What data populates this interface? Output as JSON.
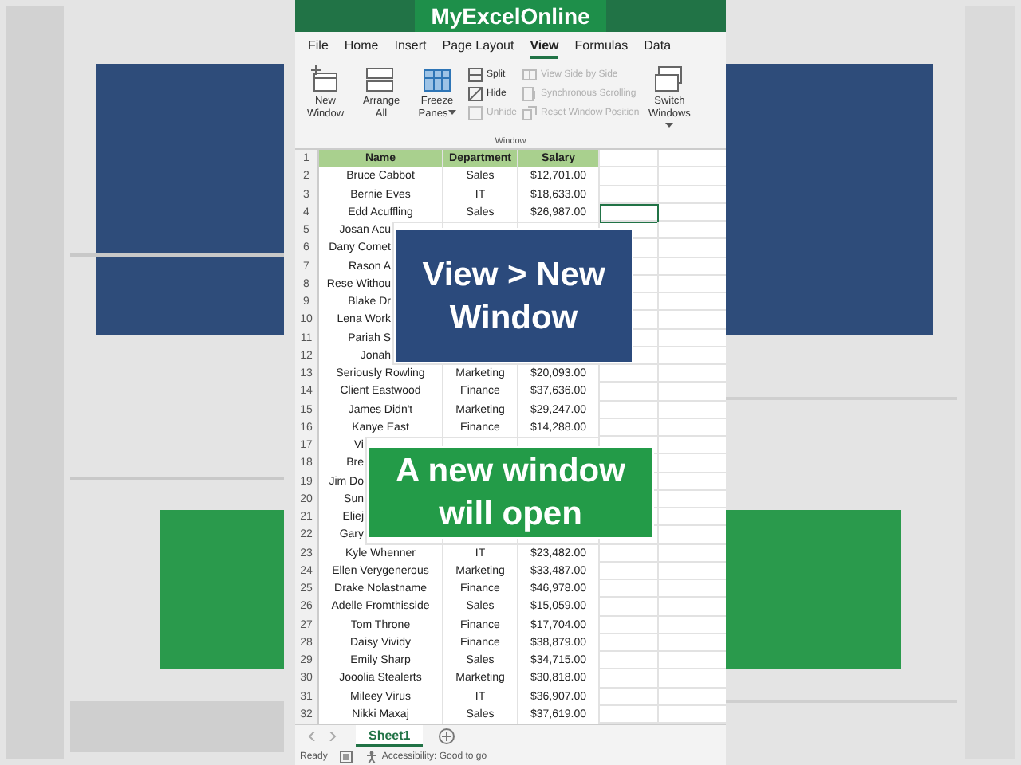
{
  "title": "MyExcelOnline",
  "tabs": [
    {
      "label": "File",
      "selected": false
    },
    {
      "label": "Home",
      "selected": false
    },
    {
      "label": "Insert",
      "selected": false
    },
    {
      "label": "Page Layout",
      "selected": false
    },
    {
      "label": "View",
      "selected": true
    },
    {
      "label": "Formulas",
      "selected": false
    },
    {
      "label": "Data",
      "selected": false
    }
  ],
  "ribbon": {
    "group": "Window",
    "commands": [
      {
        "kind": "large",
        "label": "New Window",
        "disabled": false,
        "dropdown": false
      },
      {
        "kind": "large",
        "label": "Arrange All",
        "disabled": false,
        "dropdown": false
      },
      {
        "kind": "large",
        "label": "Freeze Panes",
        "disabled": false,
        "dropdown": true
      },
      {
        "kind": "stack",
        "items": [
          {
            "label": "Split",
            "disabled": false
          },
          {
            "label": "Hide",
            "disabled": false
          },
          {
            "label": "Unhide",
            "disabled": true
          }
        ]
      },
      {
        "kind": "stack",
        "items": [
          {
            "label": "View Side by Side",
            "disabled": true
          },
          {
            "label": "Synchronous Scrolling",
            "disabled": true
          },
          {
            "label": "Reset Window Position",
            "disabled": true
          }
        ]
      },
      {
        "kind": "large",
        "label": "Switch Windows",
        "disabled": false,
        "dropdown": true
      }
    ]
  },
  "rows": [
    {
      "num": "1",
      "kind": "header",
      "active_cell": false,
      "cells": [
        "Name",
        "Department",
        "Salary"
      ]
    },
    {
      "num": "2",
      "kind": "data",
      "active_cell": false,
      "cells": [
        "Bruce Cabbot",
        "Sales",
        "$12,701.00"
      ]
    },
    {
      "num": "3",
      "kind": "data",
      "active_cell": false,
      "cells": [
        "Bernie Eves",
        "IT",
        "$18,633.00"
      ]
    },
    {
      "num": "4",
      "kind": "data",
      "active_cell": true,
      "cells": [
        "Edd Acuffling",
        "Sales",
        "$26,987.00"
      ]
    },
    {
      "num": "5",
      "kind": "data",
      "active_cell": false,
      "cells": [
        "Josan Acu"
      ]
    },
    {
      "num": "6",
      "kind": "data",
      "active_cell": false,
      "cells": [
        "Dany Comet"
      ]
    },
    {
      "num": "7",
      "kind": "data",
      "active_cell": false,
      "cells": [
        "Rason A"
      ]
    },
    {
      "num": "8",
      "kind": "data",
      "active_cell": false,
      "cells": [
        "Rese Withou"
      ]
    },
    {
      "num": "9",
      "kind": "data",
      "active_cell": false,
      "cells": [
        "Blake Dr"
      ]
    },
    {
      "num": "10",
      "kind": "data",
      "active_cell": false,
      "cells": [
        "Lena Work"
      ]
    },
    {
      "num": "11",
      "kind": "data",
      "active_cell": false,
      "cells": [
        "Pariah S"
      ]
    },
    {
      "num": "12",
      "kind": "data",
      "active_cell": false,
      "cells": [
        "Jonah"
      ]
    },
    {
      "num": "13",
      "kind": "data",
      "active_cell": false,
      "cells": [
        "Seriously Rowling",
        "Marketing",
        "$20,093.00"
      ]
    },
    {
      "num": "14",
      "kind": "data",
      "active_cell": false,
      "cells": [
        "Client Eastwood",
        "Finance",
        "$37,636.00"
      ]
    },
    {
      "num": "15",
      "kind": "data",
      "active_cell": false,
      "cells": [
        "James Didn't",
        "Marketing",
        "$29,247.00"
      ]
    },
    {
      "num": "16",
      "kind": "data",
      "active_cell": false,
      "cells": [
        "Kanye East",
        "Finance",
        "$14,288.00"
      ]
    },
    {
      "num": "17",
      "kind": "data",
      "active_cell": false,
      "cells": [
        "Vi"
      ]
    },
    {
      "num": "18",
      "kind": "data",
      "active_cell": false,
      "cells": [
        "Bre"
      ]
    },
    {
      "num": "19",
      "kind": "data",
      "active_cell": false,
      "cells": [
        "Jim Do"
      ]
    },
    {
      "num": "20",
      "kind": "data",
      "active_cell": false,
      "cells": [
        "Sun"
      ]
    },
    {
      "num": "21",
      "kind": "data",
      "active_cell": false,
      "cells": [
        "Eliej"
      ]
    },
    {
      "num": "22",
      "kind": "data",
      "active_cell": false,
      "cells": [
        "Gary"
      ]
    },
    {
      "num": "23",
      "kind": "data",
      "active_cell": false,
      "cells": [
        "Kyle Whenner",
        "IT",
        "$23,482.00"
      ]
    },
    {
      "num": "24",
      "kind": "data",
      "active_cell": false,
      "cells": [
        "Ellen Verygenerous",
        "Marketing",
        "$33,487.00"
      ]
    },
    {
      "num": "25",
      "kind": "data",
      "active_cell": false,
      "cells": [
        "Drake Nolastname",
        "Finance",
        "$46,978.00"
      ]
    },
    {
      "num": "26",
      "kind": "data",
      "active_cell": false,
      "cells": [
        "Adelle Fromthisside",
        "Sales",
        "$15,059.00"
      ]
    },
    {
      "num": "27",
      "kind": "data",
      "active_cell": false,
      "cells": [
        "Tom Throne",
        "Finance",
        "$17,704.00"
      ]
    },
    {
      "num": "28",
      "kind": "data",
      "active_cell": false,
      "cells": [
        "Daisy Vividy",
        "Finance",
        "$38,879.00"
      ]
    },
    {
      "num": "29",
      "kind": "data",
      "active_cell": false,
      "cells": [
        "Emily Sharp",
        "Sales",
        "$34,715.00"
      ]
    },
    {
      "num": "30",
      "kind": "data",
      "active_cell": false,
      "cells": [
        "Jooolia Stealerts",
        "Marketing",
        "$30,818.00"
      ]
    },
    {
      "num": "31",
      "kind": "data",
      "active_cell": false,
      "cells": [
        "Mileey Virus",
        "IT",
        "$36,907.00"
      ]
    },
    {
      "num": "32",
      "kind": "data",
      "active_cell": false,
      "cells": [
        "Nikki Maxaj",
        "Sales",
        "$37,619.00"
      ]
    }
  ],
  "callouts": [
    {
      "text": "View > New Window",
      "color": "#2b4a7c"
    },
    {
      "text": "A new window will open",
      "color": "#239b48"
    }
  ],
  "sheet_tabs": [
    {
      "label": "Sheet1",
      "selected": true
    }
  ],
  "status_bar": {
    "state": "Ready",
    "accessibility": "Accessibility: Good to go"
  }
}
